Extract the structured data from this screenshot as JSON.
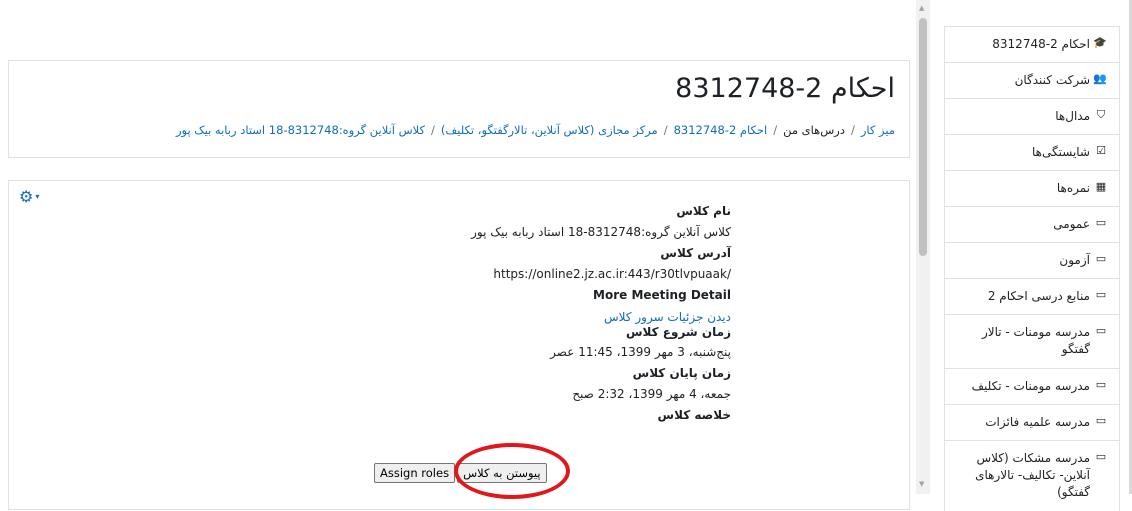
{
  "course_title": "احکام 2-8312748",
  "breadcrumb": {
    "dashboard": "میز کار",
    "my_courses": "درس‌های من",
    "course": "احکام 2-8312748",
    "section": "مرکز مجازی (کلاس آنلاین، تالارگفتگو، تکلیف)",
    "activity": "کلاس آنلاین گروه:8312748-18 استاد ربابه بیک پور",
    "separator": "/"
  },
  "class_info": {
    "name_label": "نام کلاس",
    "name_value": "کلاس آنلاین گروه:8312748-18 استاد ربابه بیک پور",
    "address_label": "آدرس کلاس",
    "address_value": "https://online2.jz.ac.ir:443/r30tlvpuaak/",
    "more_detail_label": "More Meeting Detail",
    "server_link": "دیدن جزئیات سرور کلاس",
    "start_label": "زمان شروع کلاس",
    "start_value": "پنج‌شنبه، 3 مهر 1399، 11:45 عصر",
    "end_label": "زمان پایان کلاس",
    "end_value": "جمعه، 4 مهر 1399، 2:32 صبح",
    "summary_label": "خلاصه کلاس"
  },
  "buttons": {
    "join": "پیوستن به کلاس",
    "assign_roles": "Assign roles"
  },
  "nav": {
    "items": [
      {
        "label": "احکام 2-8312748",
        "icon": "graduation-cap-icon",
        "glyph": "🎓"
      },
      {
        "label": "شرکت کنندگان",
        "icon": "users-icon",
        "glyph": "👥"
      },
      {
        "label": "مدال‌ها",
        "icon": "shield-icon",
        "glyph": "⛉"
      },
      {
        "label": "شایستگی‌ها",
        "icon": "check-square-icon",
        "glyph": "☑"
      },
      {
        "label": "نمره‌ها",
        "icon": "table-icon",
        "glyph": "▦"
      },
      {
        "label": "عمومی",
        "icon": "folder-icon",
        "glyph": "▭"
      },
      {
        "label": "آزمون",
        "icon": "folder-icon",
        "glyph": "▭"
      },
      {
        "label": "منابع درسی احکام 2",
        "icon": "folder-icon",
        "glyph": "▭"
      },
      {
        "label": "مدرسه مومنات - تالار گفتگو",
        "icon": "folder-icon",
        "glyph": "▭"
      },
      {
        "label": "مدرسه مومنات - تکلیف",
        "icon": "folder-icon",
        "glyph": "▭"
      },
      {
        "label": "مدرسه علمیه فائزات",
        "icon": "folder-icon",
        "glyph": "▭"
      },
      {
        "label": "مدرسه مشکات (کلاس آنلاین- تکالیف- تالارهای گفتگو)",
        "icon": "folder-icon",
        "glyph": "▭"
      }
    ]
  },
  "icons": {
    "settings": "gear-icon",
    "gear_glyph": "⚙",
    "caret_glyph": "▾",
    "scroll_up_glyph": "▲",
    "scroll_down_glyph": "▼"
  },
  "colors": {
    "link": "#0f6cbf",
    "highlight_circle": "#e0171b",
    "border": "#dee2e6"
  }
}
